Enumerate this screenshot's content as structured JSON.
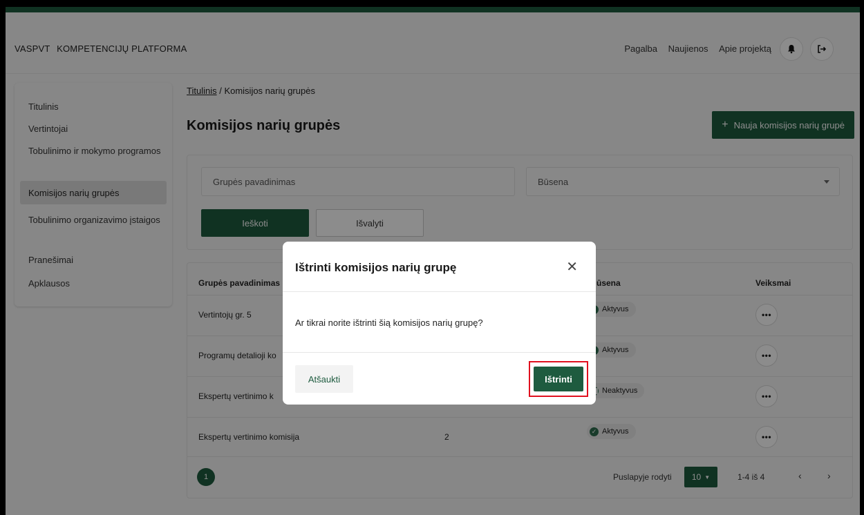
{
  "header": {
    "brand_short": "VASPVT",
    "brand_name": "KOMPETENCIJŲ PLATFORMA",
    "links": [
      "Pagalba",
      "Naujienos",
      "Apie projektą"
    ],
    "bell_icon": "bell-icon",
    "logout_icon": "logout-icon"
  },
  "sidebar": {
    "items": [
      {
        "label": "Titulinis"
      },
      {
        "label": "Vertintojai"
      },
      {
        "label": "Tobulinimo ir mokymo programos"
      },
      {
        "label": "Komisijos narių grupės",
        "active": true
      },
      {
        "label": "Tobulinimo organizavimo įstaigos"
      },
      {
        "label": "Pranešimai"
      },
      {
        "label": "Apklausos"
      }
    ]
  },
  "breadcrumb": {
    "root": "Titulinis",
    "separator": " / ",
    "current": "Komisijos narių grupės"
  },
  "page": {
    "title": "Komisijos narių grupės",
    "new_button": "Nauja komisijos narių grupė"
  },
  "filters": {
    "name_placeholder": "Grupės pavadinimas",
    "status_placeholder": "Būsena",
    "search_button": "Ieškoti",
    "clear_button": "Išvalyti"
  },
  "table": {
    "columns": [
      "Grupės pavadinimas",
      "ūsena",
      "Veiksmai"
    ],
    "rows": [
      {
        "name": "Vertintojų gr. 5",
        "count": "",
        "status": "Aktyvus"
      },
      {
        "name": "Programų detalioji ko",
        "count": "",
        "status": "Aktyvus"
      },
      {
        "name": "Ekspertų vertinimo k",
        "count": "",
        "status": "Neaktyvus"
      },
      {
        "name": "Ekspertų vertinimo komisija",
        "count": "2",
        "status": "Aktyvus"
      }
    ]
  },
  "pagination": {
    "current_page": "1",
    "per_page_label": "Puslapyje rodyti",
    "per_page_value": "10",
    "range": "1-4 iš 4",
    "prev": "‹",
    "next": "›"
  },
  "modal": {
    "title": "Ištrinti komisijos narių grupę",
    "close": "✕",
    "message": "Ar tikrai norite ištrinti šią komisijos narių grupę?",
    "cancel_button": "Atšaukti",
    "delete_button": "Ištrinti"
  },
  "colors": {
    "primary": "#1e5b3f",
    "highlight": "#e0101e"
  }
}
